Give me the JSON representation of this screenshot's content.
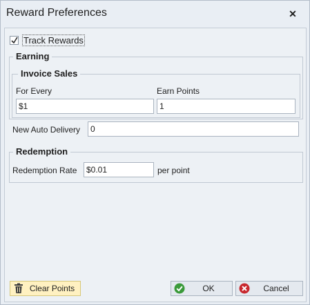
{
  "window": {
    "title": "Reward Preferences",
    "close_glyph": "✕"
  },
  "track_rewards": {
    "label": "Track Rewards",
    "checked": true
  },
  "earning": {
    "title": "Earning",
    "invoice_sales": {
      "title": "Invoice Sales",
      "for_every_label": "For Every",
      "for_every_value": "$1",
      "earn_points_label": "Earn Points",
      "earn_points_value": "1"
    },
    "new_auto_delivery_label": "New Auto Delivery",
    "new_auto_delivery_value": "0"
  },
  "redemption": {
    "title": "Redemption",
    "rate_label": "Redemption Rate",
    "rate_value": "$0.01",
    "per_point_label": "per point"
  },
  "buttons": {
    "clear_points": "Clear Points",
    "ok": "OK",
    "cancel": "Cancel"
  },
  "icons": {
    "close": "close-icon",
    "clear": "trash-icon",
    "ok": "check-circle-icon",
    "cancel": "x-circle-icon"
  },
  "colors": {
    "ok_green": "#3a9a3a",
    "cancel_red": "#c8282e",
    "clear_bg": "#fff1c1"
  }
}
